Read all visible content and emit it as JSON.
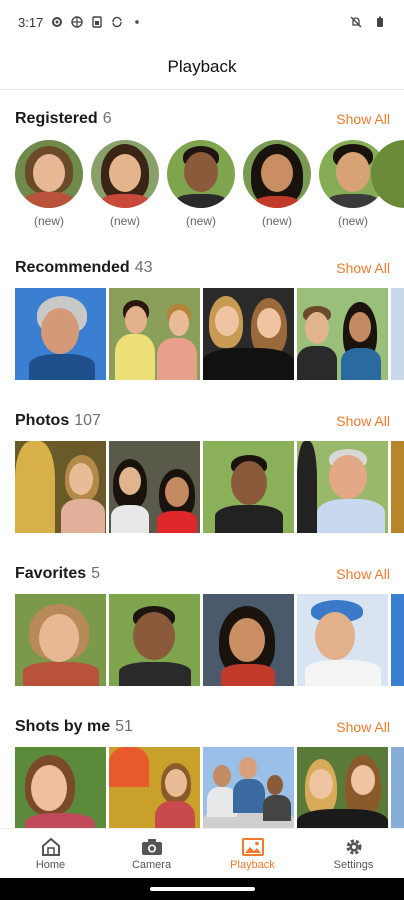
{
  "status_bar": {
    "time": "3:17",
    "icons_left": [
      "settings-icon",
      "globe-icon",
      "sim-icon",
      "sync-icon",
      "dot-icon"
    ],
    "icons_right": [
      "notifications-off-icon",
      "battery-icon"
    ]
  },
  "header": {
    "title": "Playback"
  },
  "sections": {
    "registered": {
      "title": "Registered",
      "count": "6",
      "show_all": "Show All",
      "people": [
        {
          "caption": "(new)"
        },
        {
          "caption": "(new)"
        },
        {
          "caption": "(new)"
        },
        {
          "caption": "(new)"
        },
        {
          "caption": "(new)"
        }
      ]
    },
    "recommended": {
      "title": "Recommended",
      "count": "43",
      "show_all": "Show All"
    },
    "photos": {
      "title": "Photos",
      "count": "107",
      "show_all": "Show All"
    },
    "favorites": {
      "title": "Favorites",
      "count": "5",
      "show_all": "Show All"
    },
    "shots": {
      "title": "Shots by me",
      "count": "51",
      "show_all": "Show All"
    }
  },
  "bottom_nav": {
    "items": [
      {
        "label": "Home",
        "icon": "home-icon"
      },
      {
        "label": "Camera",
        "icon": "camera-icon"
      },
      {
        "label": "Playback",
        "icon": "image-icon",
        "active": true
      },
      {
        "label": "Settings",
        "icon": "gear-icon"
      }
    ]
  },
  "colors": {
    "accent": "#f07a2e",
    "text": "#1a1a1a",
    "muted": "#707070"
  }
}
